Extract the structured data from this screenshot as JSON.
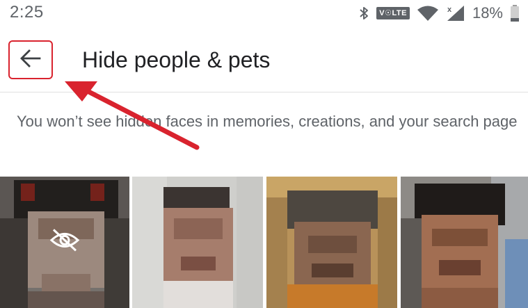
{
  "status_bar": {
    "time": "2:25",
    "network_badge": "V☉LTE",
    "battery_percent": "18%",
    "icons": [
      "bluetooth-icon",
      "volte-icon",
      "wifi-icon",
      "cellular-signal-icon",
      "battery-icon"
    ]
  },
  "toolbar": {
    "back_icon": "arrow-back-icon",
    "title": "Hide people & pets"
  },
  "description": {
    "text": "You won’t see hidden faces in memories, creations, and your search page"
  },
  "faces": [
    {
      "name": "face-1",
      "hidden": true,
      "overlay_icon": "eye-off-icon"
    },
    {
      "name": "face-2",
      "hidden": false
    },
    {
      "name": "face-3",
      "hidden": false
    },
    {
      "name": "face-4",
      "hidden": false
    }
  ],
  "colors": {
    "annotation_red": "#d9232e",
    "title_text": "#202124",
    "secondary_text": "#5f6368"
  }
}
